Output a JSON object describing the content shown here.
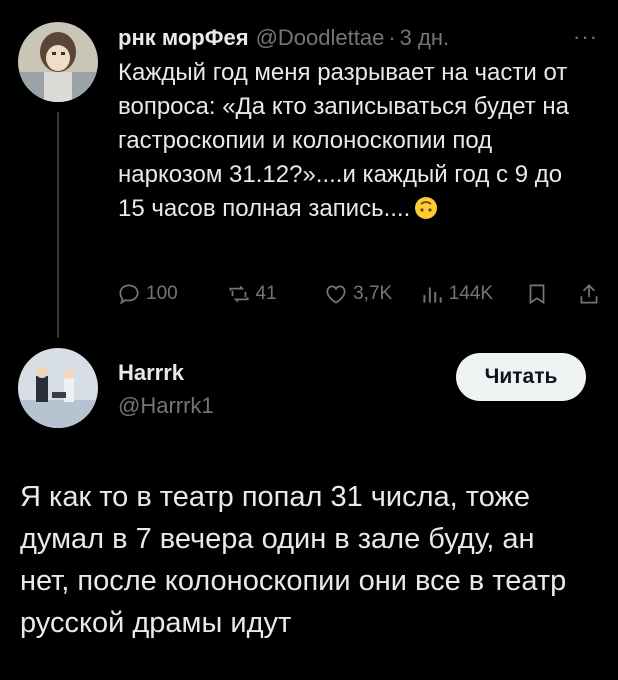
{
  "tweet1": {
    "author_name": "рнк морФея",
    "handle": "@Doodlettae",
    "separator": "·",
    "time": "3 дн.",
    "more_label": "···",
    "text": "Каждый год меня разрывает на части от вопроса: «Да кто записываться будет на гастроскопии и колоноскопии под наркозом 31.12?»....и каждый год с 9 до 15 часов полная запись....",
    "emoji": "upside-down-face",
    "stats": {
      "replies": "100",
      "reposts": "41",
      "likes": "3,7K",
      "views": "144K"
    },
    "icons": [
      "reply-icon",
      "repost-icon",
      "like-icon",
      "views-icon",
      "bookmark-icon",
      "share-icon"
    ]
  },
  "tweet2": {
    "author_name": "Harrrk",
    "handle": "@Harrrk1",
    "follow_label": "Читать",
    "text": "Я как то в театр попал 31 числа, тоже думал в 7 вечера один в зале буду, ан нет, после колоноскопии они все в театр русской драмы идут"
  },
  "colors": {
    "background": "#000000",
    "text": "#e7e9ea",
    "muted": "#71767b",
    "button_bg": "#eff3f4",
    "thread_line": "#333639"
  }
}
